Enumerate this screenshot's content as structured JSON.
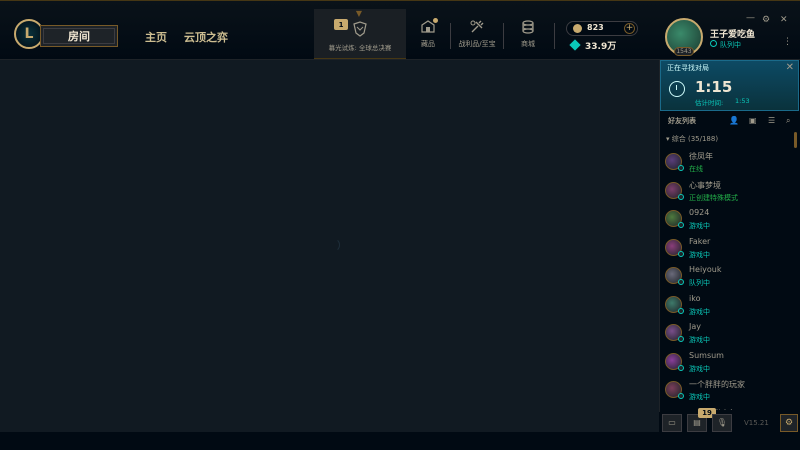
{
  "topbar": {
    "logo_text": "L",
    "room_label": "房间",
    "nav": {
      "home": "主页",
      "tft": "云顶之弈"
    },
    "event": {
      "badge": "1",
      "label": "幕光试炼: 全球总决赛"
    },
    "icons": [
      {
        "name": "collection-icon",
        "label": "藏品"
      },
      {
        "name": "loot-icon",
        "label": "战利品/至宝"
      },
      {
        "name": "store-icon",
        "label": "商城"
      }
    ],
    "currency": {
      "rp": "823",
      "plus": "+",
      "be": "33.9万"
    },
    "player": {
      "name": "王子爱吃鱼",
      "status": "队列中",
      "level": "1543"
    },
    "window": {
      "min": "—",
      "gear": "⚙",
      "close": "✕",
      "more": "⋮"
    }
  },
  "queue": {
    "title": "正在寻找对局",
    "close": "✕",
    "timer": "1:15",
    "est_label": "估计时间:",
    "est_value": "1:53"
  },
  "friends": {
    "header": "好友列表",
    "group": "▾ 综合 (35/188)",
    "items": [
      {
        "name": "徐凤年",
        "status": "在线",
        "status_color": "#23b04a",
        "avatar": "#5a3e7a"
      },
      {
        "name": "心事梦境",
        "status": "正创建特殊模式",
        "status_color": "#23b04a",
        "avatar": "#7a3e6a"
      },
      {
        "name": "0924",
        "status": "游戏中",
        "status_color": "#0ac8b9",
        "avatar": "#4e7a3e"
      },
      {
        "name": "Faker",
        "status": "游戏中",
        "status_color": "#0ac8b9",
        "avatar": "#8a3e7a"
      },
      {
        "name": "Heiyouk",
        "status": "队列中",
        "status_color": "#0ac8b9",
        "avatar": "#6a6a7a"
      },
      {
        "name": "iko",
        "status": "游戏中",
        "status_color": "#0ac8b9",
        "avatar": "#3e7a6a"
      },
      {
        "name": "Jay",
        "status": "游戏中",
        "status_color": "#0ac8b9",
        "avatar": "#7a4e8a"
      },
      {
        "name": "Sumsum",
        "status": "游戏中",
        "status_color": "#0ac8b9",
        "avatar": "#8a3e9a"
      },
      {
        "name": "一个胖胖的玩家",
        "status": "游戏中",
        "status_color": "#0ac8b9",
        "avatar": "#7a3e5a"
      },
      {
        "name": "一梦须当人年",
        "status": "",
        "status_color": "#0ac8b9",
        "avatar": "#3e6a7a"
      }
    ]
  },
  "bottom": {
    "badge": "19",
    "version": "V15.21"
  }
}
